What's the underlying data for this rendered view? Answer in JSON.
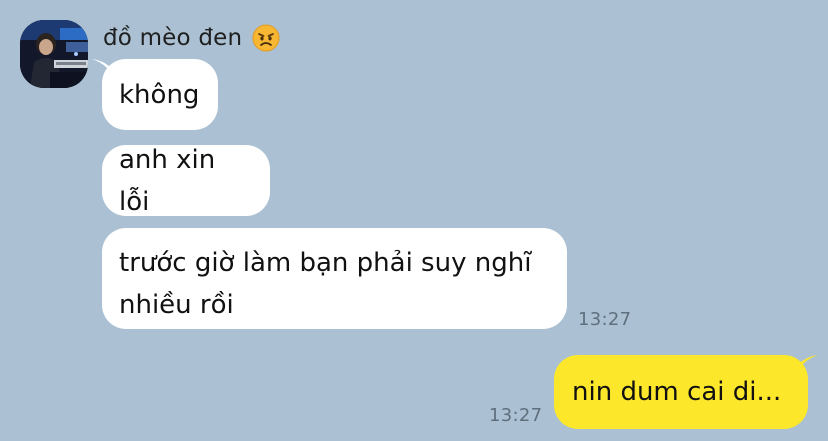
{
  "conversation": {
    "contact": {
      "name": "đồ mèo đen",
      "name_emoji_icon": "angry-face-emoji-icon",
      "avatar_icon": "contact-avatar-photo"
    },
    "incoming": [
      {
        "text": "không"
      },
      {
        "text": "anh xin lỗi"
      },
      {
        "lines": [
          "trước giờ làm bạn phải suy nghĩ",
          "nhiều rồi"
        ]
      }
    ],
    "incoming_time": "13:27",
    "outgoing": [
      {
        "text": "nin dum cai di..."
      }
    ],
    "outgoing_time": "13:27"
  },
  "colors": {
    "background": "#abc1d3",
    "incoming_bubble": "#ffffff",
    "outgoing_bubble": "#fde72a",
    "timestamp": "#5f6f7d"
  }
}
